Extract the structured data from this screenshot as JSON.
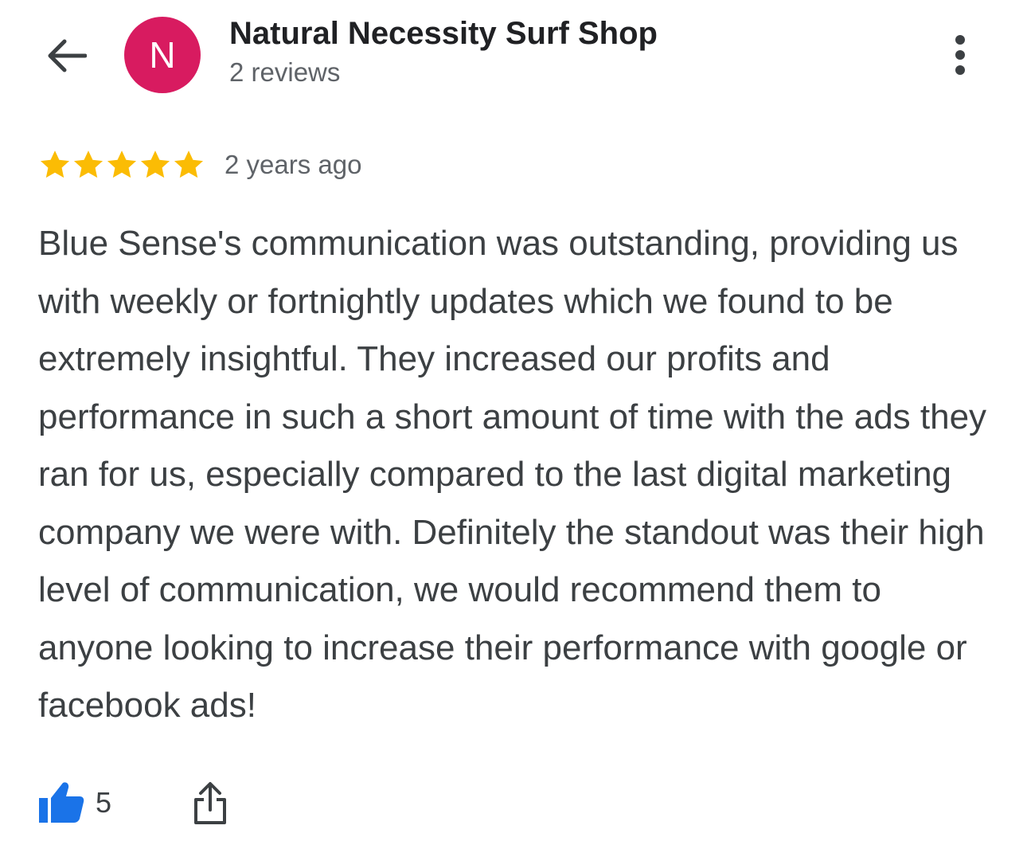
{
  "header": {
    "back_icon": "arrow-back-icon",
    "avatar_letter": "N",
    "avatar_color": "#d81b60",
    "reviewer_name": "Natural Necessity Surf Shop",
    "reviewer_meta": "2 reviews",
    "more_icon": "more-vert-icon"
  },
  "review": {
    "rating": 5,
    "rating_max": 5,
    "star_color": "#fbbc04",
    "time_ago": "2 years ago",
    "text": "Blue Sense's communication was outstanding, providing us with weekly or fortnightly updates which we found to be extremely insightful. They increased our profits and performance in such a short amount of time with the ads they ran for us, especially compared to the last digital marketing company we were with. Definitely the standout was their high level of communication, we would recommend them to anyone looking to increase their performance with google or facebook ads!"
  },
  "actions": {
    "like_icon": "thumbs-up-icon",
    "like_color": "#1a73e8",
    "like_count": "5",
    "share_icon": "share-icon"
  }
}
